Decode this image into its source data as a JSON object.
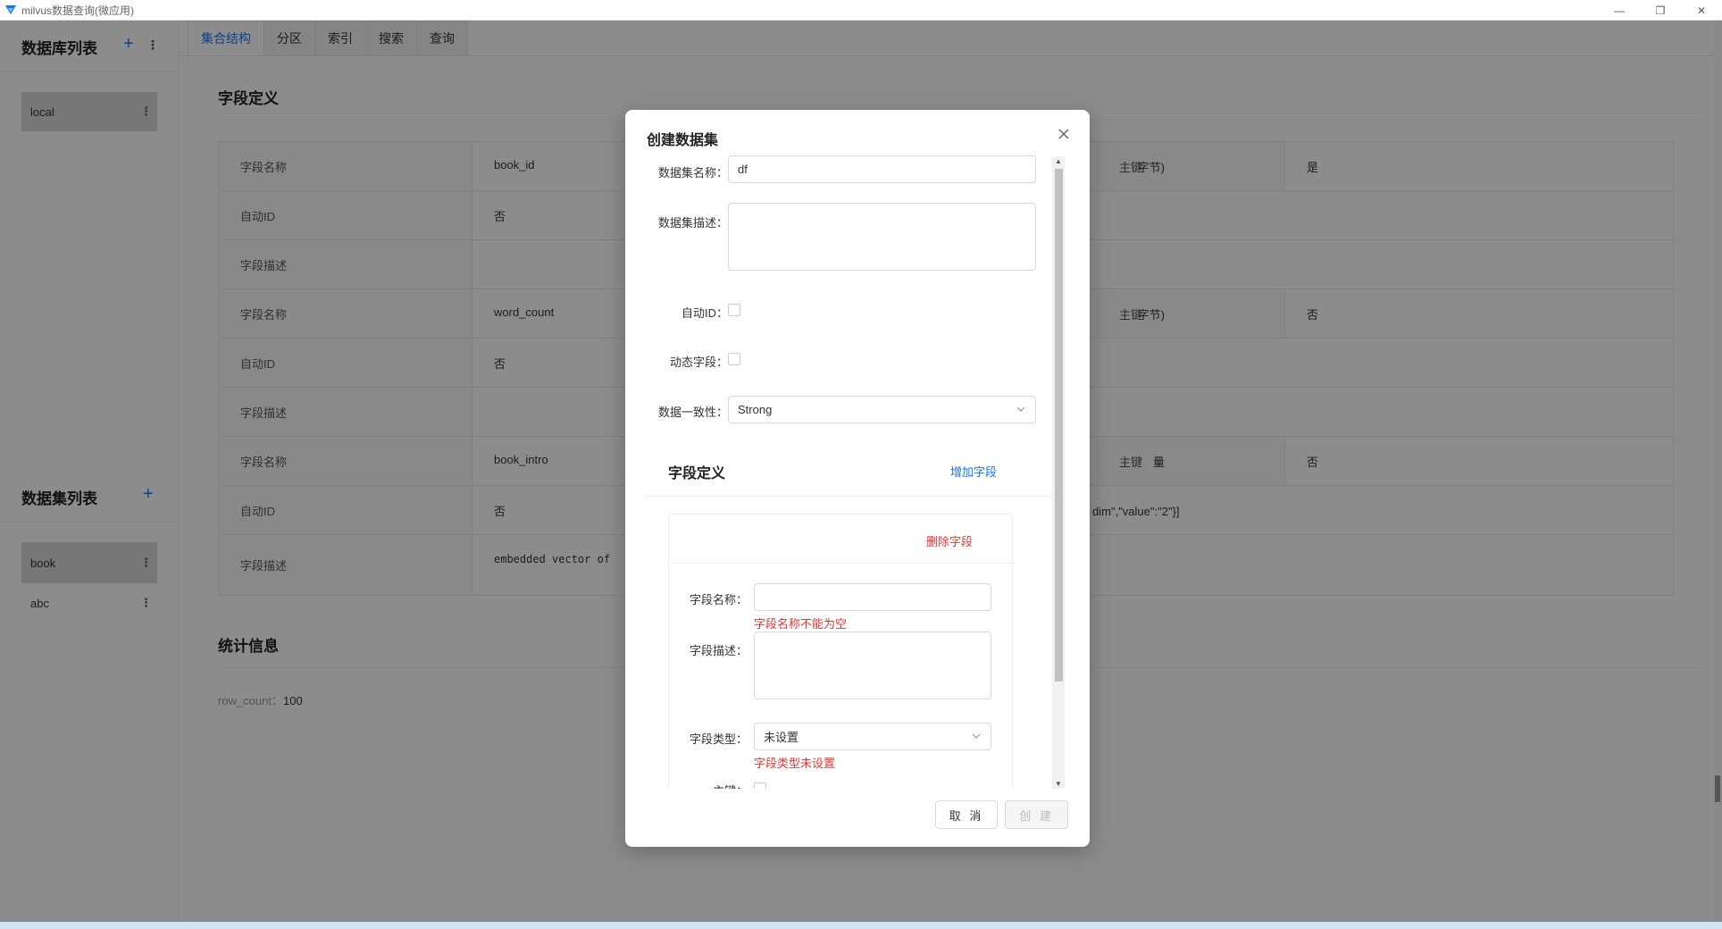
{
  "window": {
    "title": "milvus数据查询(微应用)",
    "controls": {
      "minimize": "—",
      "restore": "❐",
      "close": "✕"
    },
    "accent": "#1677ff"
  },
  "sidebar": {
    "db_title": "数据库列表",
    "add_glyph": "+",
    "more_glyph": "⋮",
    "databases": [
      {
        "label": "local",
        "active": true
      }
    ],
    "collection_title": "数据集列表",
    "collections": [
      {
        "label": "book",
        "active": true
      },
      {
        "label": "abc",
        "active": false
      }
    ]
  },
  "tabs": [
    {
      "label": "集合结构",
      "active": true
    },
    {
      "label": "分区",
      "active": false
    },
    {
      "label": "索引",
      "active": false
    },
    {
      "label": "搜索",
      "active": false
    },
    {
      "label": "查询",
      "active": false
    }
  ],
  "main": {
    "field_def_title": "字段定义",
    "stats_title": "统计信息",
    "fields": [
      {
        "name_label": "字段名称",
        "name": "book_id",
        "type_tail": "字节)",
        "pk_label": "主键",
        "pk": "是",
        "auto_label": "自动ID",
        "auto": "否",
        "extra": "",
        "desc_label": "字段描述",
        "desc": ""
      },
      {
        "name_label": "字段名称",
        "name": "word_count",
        "type_tail": "字节)",
        "pk_label": "主键",
        "pk": "否",
        "auto_label": "自动ID",
        "auto": "否",
        "extra": "",
        "desc_label": "字段描述",
        "desc": ""
      },
      {
        "name_label": "字段名称",
        "name": "book_intro",
        "type_tail": "量",
        "pk_label": "主键",
        "pk": "否",
        "auto_label": "自动ID",
        "auto": "否",
        "extra": "dim\",\"value\":\"2\"}]",
        "desc_label": "字段描述",
        "desc": "embedded vector of"
      }
    ],
    "stats": {
      "label": "row_count：",
      "value": "100"
    }
  },
  "modal": {
    "title": "创建数据集",
    "close_glyph": "✕",
    "name_label": "数据集名称：",
    "name_value": "df",
    "desc_label": "数据集描述：",
    "desc_value": "",
    "auto_id_label": "自动ID：",
    "dynamic_label": "动态字段：",
    "consistency_label": "数据一致性：",
    "consistency_value": "Strong",
    "field_section_title": "字段定义",
    "add_field": "增加字段",
    "delete_field": "删除字段",
    "field_name_label": "字段名称：",
    "field_name_value": "",
    "field_name_error": "字段名称不能为空",
    "field_desc_label": "字段描述：",
    "field_desc_value": "",
    "field_type_label": "字段类型：",
    "field_type_value": "未设置",
    "field_type_error": "字段类型未设置",
    "pk_label": "主键：",
    "cancel": "取 消",
    "create": "创 建",
    "error_color": "#e53935"
  }
}
